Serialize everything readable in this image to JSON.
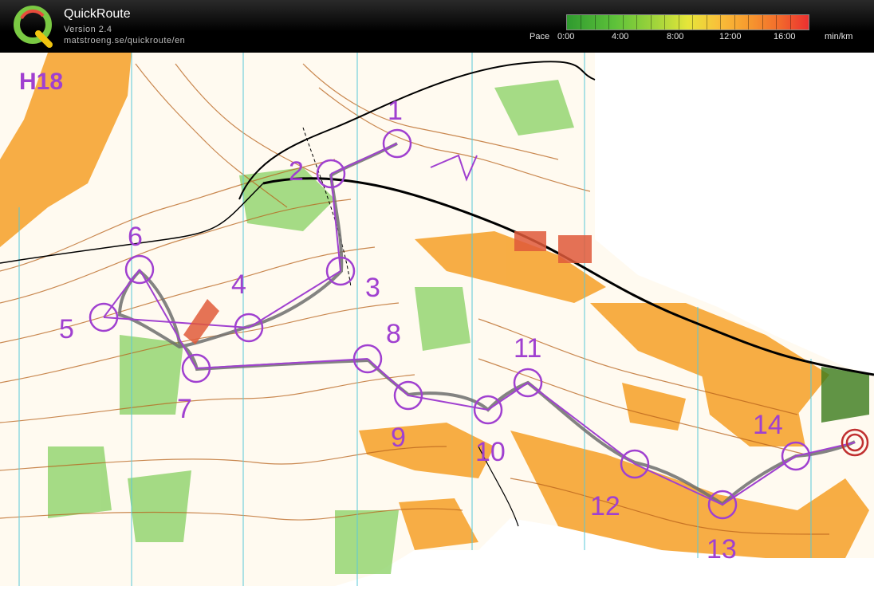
{
  "app": {
    "name": "QuickRoute",
    "version": "Version 2.4",
    "url": "matstroeng.se/quickroute/en"
  },
  "pace": {
    "label": "Pace",
    "ticks": [
      "0:00",
      "4:00",
      "8:00",
      "12:00",
      "16:00"
    ],
    "unit": "min/km",
    "colors": {
      "fast": "#2f9a2f",
      "medium": "#e6e63a",
      "slow": "#ec3030"
    }
  },
  "map": {
    "class_title": "H18",
    "course_color": "#a040d0",
    "controls": [
      "1",
      "2",
      "3",
      "4",
      "5",
      "6",
      "7",
      "8",
      "9",
      "10",
      "11",
      "12",
      "13",
      "14"
    ]
  }
}
